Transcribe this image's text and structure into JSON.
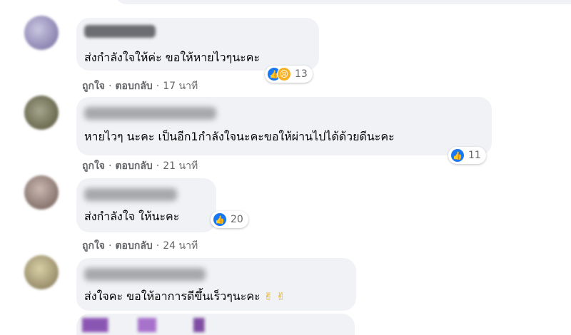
{
  "comments": [
    {
      "text": "ส่งกำลังใจให้ค่ะ ขอให้หายไวๆนะคะ",
      "reaction_count": "13",
      "like_label": "ถูกใจ",
      "reply_label": "ตอบกลับ",
      "dot": "·",
      "time": "17 นาที"
    },
    {
      "text": "หายไวๆ นะคะ เป็นอีก1กำลังใจนะคะขอให้ผ่านไปได้ด้วยดีนะคะ",
      "reaction_count": "11",
      "like_label": "ถูกใจ",
      "reply_label": "ตอบกลับ",
      "dot": "·",
      "time": "21 นาที"
    },
    {
      "text": "ส่งกำลังใจ ให้นะคะ",
      "reaction_count": "20",
      "like_label": "ถูกใจ",
      "reply_label": "ตอบกลับ",
      "dot": "·",
      "time": "24 นาที"
    },
    {
      "text": "ส่งใจคะ ขอให้อาการดีขึ้นเร็วๆนะคะ",
      "emoji": "✌ ✌"
    }
  ],
  "icons": {
    "like": "like-icon",
    "sad": "sad-icon",
    "victory": "victory-hand-icon"
  },
  "colors": {
    "bubble": "#f0f2f5",
    "like_blue": "#1877f2",
    "meta_gray": "#65676b",
    "text": "#050505"
  }
}
